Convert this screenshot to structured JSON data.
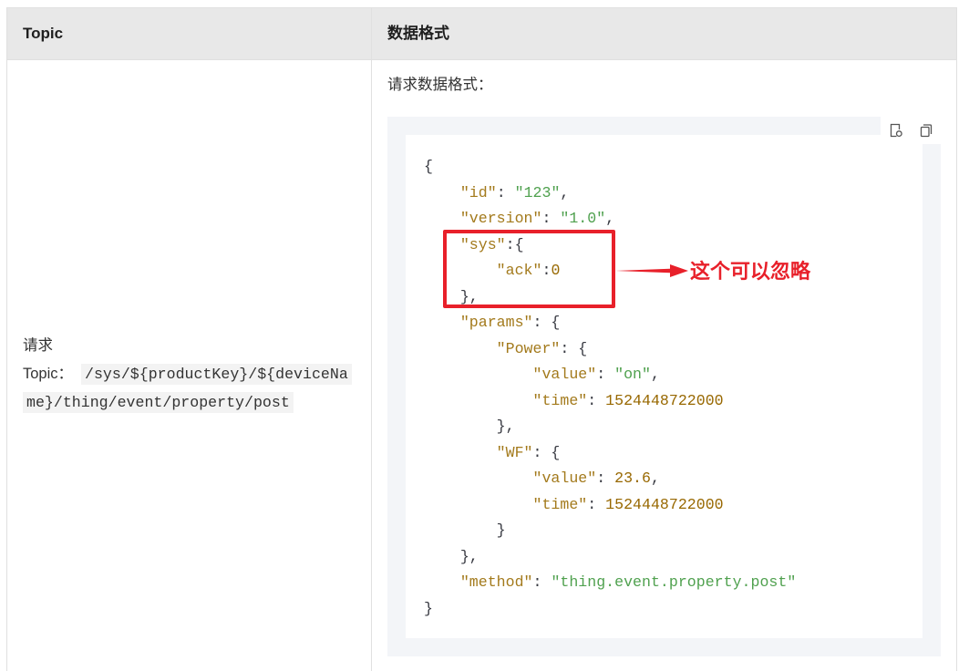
{
  "table": {
    "headers": {
      "topic": "Topic",
      "data_format": "数据格式"
    },
    "request_row": {
      "label": "请求",
      "topic_prefix": "Topic：",
      "topic_path": "/sys/${productKey}/${deviceName}/thing/event/property/post"
    },
    "format_cell": {
      "label": "请求数据格式：",
      "toolbar": {
        "icons": [
          "preview-icon",
          "copy-icon"
        ]
      },
      "code": {
        "lines": [
          [
            [
              "p",
              "{"
            ]
          ],
          [
            [
              "w",
              "    "
            ],
            [
              "k",
              "\"id\""
            ],
            [
              "p",
              ": "
            ],
            [
              "s",
              "\"123\""
            ],
            [
              "p",
              ","
            ]
          ],
          [
            [
              "w",
              "    "
            ],
            [
              "k",
              "\"version\""
            ],
            [
              "p",
              ": "
            ],
            [
              "s",
              "\"1.0\""
            ],
            [
              "p",
              ","
            ]
          ],
          [
            [
              "w",
              "    "
            ],
            [
              "k",
              "\"sys\""
            ],
            [
              "p",
              ":{"
            ]
          ],
          [
            [
              "w",
              "        "
            ],
            [
              "k",
              "\"ack\""
            ],
            [
              "p",
              ":"
            ],
            [
              "n",
              "0"
            ]
          ],
          [
            [
              "w",
              "    "
            ],
            [
              "p",
              "},"
            ]
          ],
          [
            [
              "w",
              "    "
            ],
            [
              "k",
              "\"params\""
            ],
            [
              "p",
              ": {"
            ]
          ],
          [
            [
              "w",
              "        "
            ],
            [
              "k",
              "\"Power\""
            ],
            [
              "p",
              ": {"
            ]
          ],
          [
            [
              "w",
              "            "
            ],
            [
              "k",
              "\"value\""
            ],
            [
              "p",
              ": "
            ],
            [
              "s",
              "\"on\""
            ],
            [
              "p",
              ","
            ]
          ],
          [
            [
              "w",
              "            "
            ],
            [
              "k",
              "\"time\""
            ],
            [
              "p",
              ": "
            ],
            [
              "n",
              "1524448722000"
            ]
          ],
          [
            [
              "w",
              "        "
            ],
            [
              "p",
              "},"
            ]
          ],
          [
            [
              "w",
              "        "
            ],
            [
              "k",
              "\"WF\""
            ],
            [
              "p",
              ": {"
            ]
          ],
          [
            [
              "w",
              "            "
            ],
            [
              "k",
              "\"value\""
            ],
            [
              "p",
              ": "
            ],
            [
              "n",
              "23.6"
            ],
            [
              "p",
              ","
            ]
          ],
          [
            [
              "w",
              "            "
            ],
            [
              "k",
              "\"time\""
            ],
            [
              "p",
              ": "
            ],
            [
              "n",
              "1524448722000"
            ]
          ],
          [
            [
              "w",
              "        "
            ],
            [
              "p",
              "}"
            ]
          ],
          [
            [
              "w",
              "    "
            ],
            [
              "p",
              "},"
            ]
          ],
          [
            [
              "w",
              "    "
            ],
            [
              "k",
              "\"method\""
            ],
            [
              "p",
              ": "
            ],
            [
              "s",
              "\"thing.event.property.post\""
            ]
          ],
          [
            [
              "p",
              "}"
            ]
          ]
        ]
      }
    }
  },
  "annotation": {
    "text": "这个可以忽略",
    "color": "#e8202a"
  },
  "colors": {
    "header_bg": "#e8e8e8",
    "code_bg": "#f3f5f8",
    "syntax": {
      "key": "#a37a1c",
      "string": "#50a14f",
      "number": "#986801",
      "punct": "#383a42"
    }
  }
}
